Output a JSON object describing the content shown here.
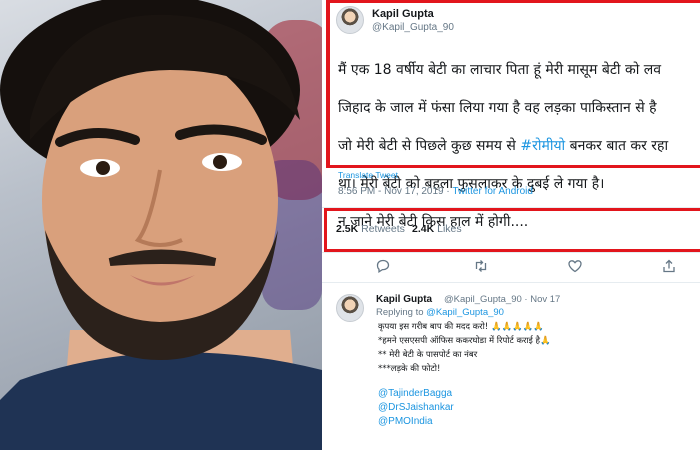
{
  "tweet": {
    "author_name": "Kapil Gupta",
    "author_handle": "@Kapil_Gupta_90",
    "text_lines": [
      "मैं एक 18 वर्षीय बेटी का लाचार पिता हूं मेरी मासूम बेटी को लव",
      "जिहाद के जाल में फंसा लिया गया है वह लड़का पाकिस्तान से है",
      "जो मेरी बेटी से पिछले कुछ समय से #रोमीयो बनकर बात कर रहा",
      "था। मेरी बेटी को बहला फुसलाकर के दुबई ले गया है।",
      "न जाने मेरी बेटी किस हाल में होगी...."
    ],
    "hashtag": "#रोमीयो",
    "translate_label": "Translate Tweet",
    "timestamp": "8:56 PM - Nov 17, 2019",
    "separator": " · ",
    "source": "Twitter for Android",
    "retweets_count": "2.5K",
    "retweets_label": "Retweets",
    "likes_count": "2.4K",
    "likes_label": "Likes",
    "actions": [
      "reply-icon",
      "retweet-icon",
      "like-icon",
      "share-icon"
    ]
  },
  "reply": {
    "author_name": "Kapil Gupta",
    "author_handle": "@Kapil_Gupta_90 · Nov 17",
    "replying_label": "Replying to",
    "replying_to": "@Kapil_Gupta_90",
    "lines": [
      "कृपया इस गरीब बाप की मदद करो! 🙏🙏🙏🙏🙏",
      "*हमने एसएसपी ऑफिस ककरघोडा में रिपोर्ट कराई है🙏",
      "** मेरी बेटी के पासपोर्ट का नंबर",
      "***लड़के की फोटो!"
    ],
    "mentions": [
      "@TajinderBagga",
      "@DrSJaishankar",
      "@PMOIndia"
    ]
  },
  "colors": {
    "highlight": "#e2151c",
    "link": "#1b95e0",
    "muted": "#657786"
  }
}
